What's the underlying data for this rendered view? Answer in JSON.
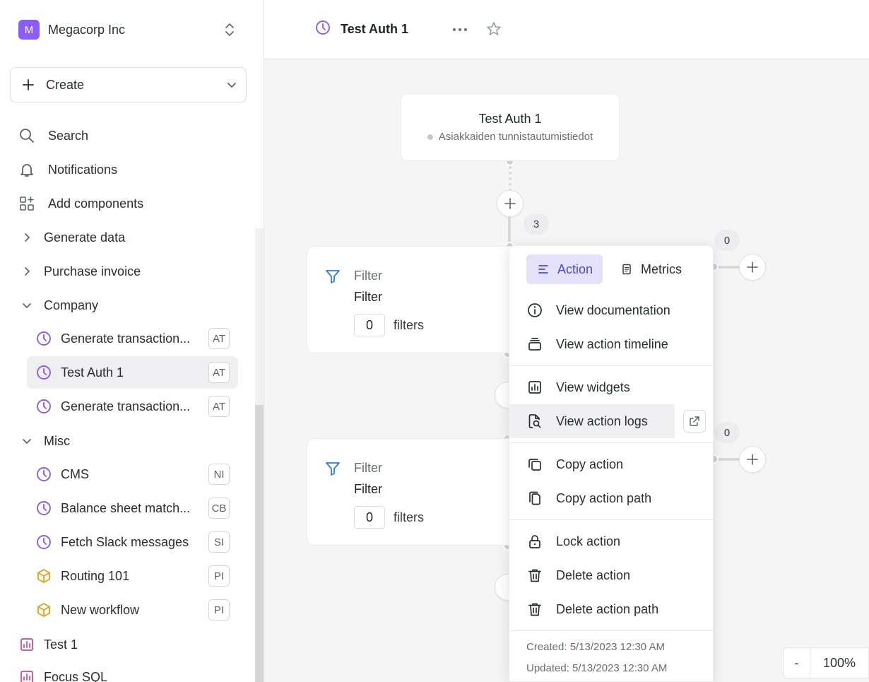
{
  "org": {
    "badge": "M",
    "name": "Megacorp Inc"
  },
  "create": {
    "label": "Create"
  },
  "nav": {
    "search": "Search",
    "notifications": "Notifications",
    "add_components": "Add components"
  },
  "folders": {
    "generate_data": "Generate data",
    "purchase_invoice": "Purchase invoice",
    "company": "Company",
    "misc": "Misc"
  },
  "company_items": [
    {
      "label": "Generate transaction...",
      "tag": "AT"
    },
    {
      "label": "Test Auth 1",
      "tag": "AT"
    },
    {
      "label": "Generate transaction...",
      "tag": "AT"
    }
  ],
  "misc_items": [
    {
      "label": "CMS",
      "tag": "NI"
    },
    {
      "label": "Balance sheet match...",
      "tag": "CB"
    },
    {
      "label": "Fetch Slack messages",
      "tag": "SI"
    },
    {
      "label": "Routing 101",
      "tag": "PI"
    },
    {
      "label": "New workflow",
      "tag": "PI"
    }
  ],
  "dashboards": {
    "test1": "Test 1",
    "focus_sql": "Focus SQL"
  },
  "header": {
    "title": "Test Auth 1"
  },
  "trigger": {
    "title": "Test Auth 1",
    "subtitle": "Asiakkaiden tunnistautumistiedot"
  },
  "counts": {
    "main": "3",
    "branch1": "0",
    "branch2": "0"
  },
  "filters": [
    {
      "kind": "Filter",
      "name": "Filter",
      "count": "0",
      "count_label": "filters"
    },
    {
      "kind": "Filter",
      "name": "Filter",
      "count": "0",
      "count_label": "filters"
    }
  ],
  "menu": {
    "tab_action": "Action",
    "tab_metrics": "Metrics",
    "view_documentation": "View documentation",
    "view_timeline": "View action timeline",
    "view_widgets": "View widgets",
    "view_logs": "View action logs",
    "copy_action": "Copy action",
    "copy_path": "Copy action path",
    "lock_action": "Lock action",
    "delete_action": "Delete action",
    "delete_path": "Delete action path",
    "created": "Created: 5/13/2023 12:30 AM",
    "updated": "Updated: 5/13/2023 12:30 AM"
  },
  "zoom": {
    "minus": "-",
    "value": "100%"
  },
  "colors": {
    "accent": "#8b5cf6",
    "tab_active_bg": "#e4e2fb",
    "filter_icon": "#2f7bdc",
    "cube_icon": "#e0a11b",
    "chart_icon": "#d0448c"
  }
}
